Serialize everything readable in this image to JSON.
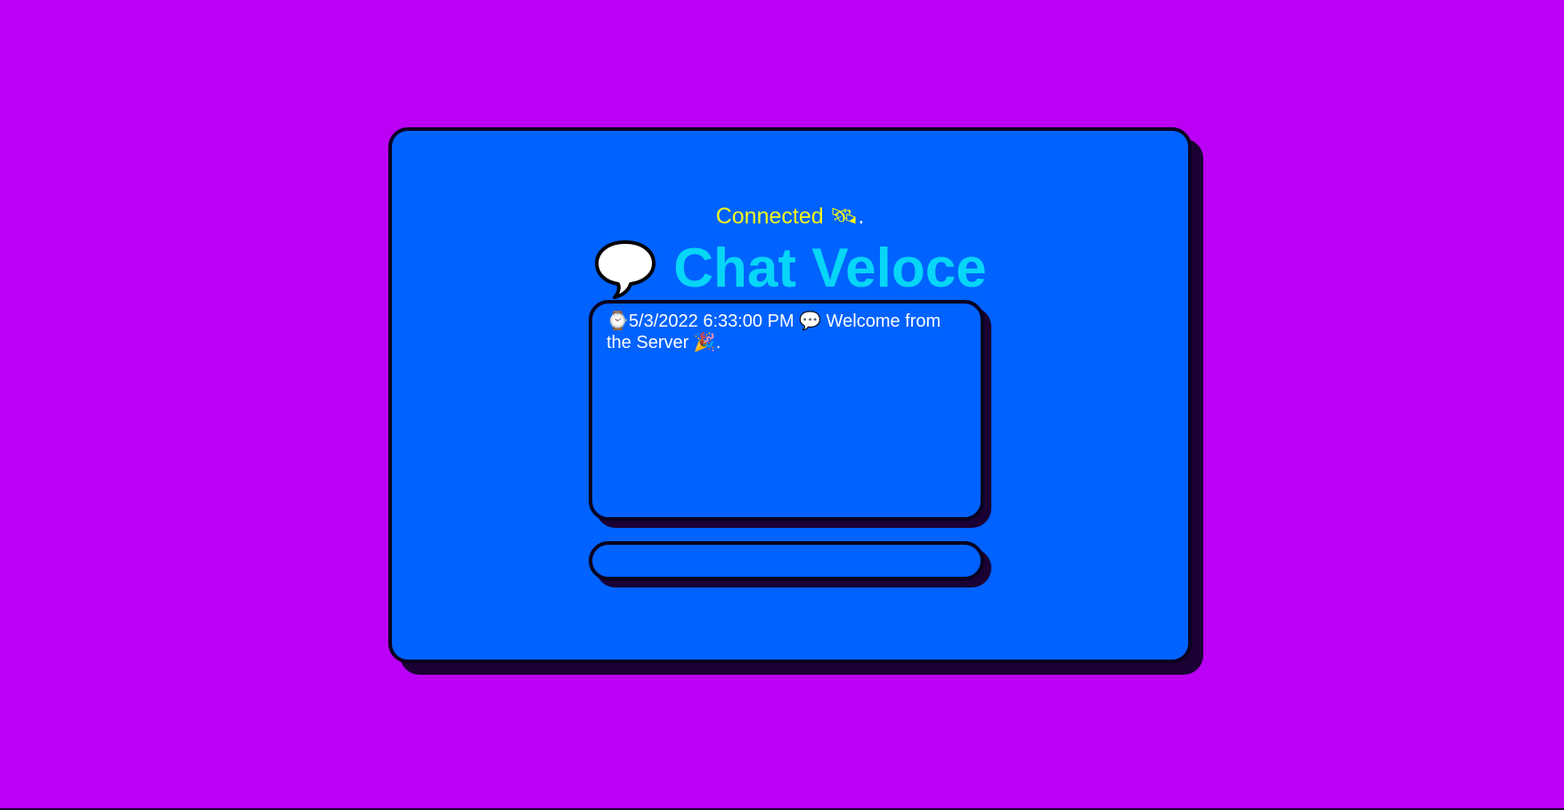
{
  "app": {
    "status_text": "Connected 🛰",
    "status_dot": ".",
    "title": "Chat Veloce",
    "title_icon": "speech-balloon-icon"
  },
  "messages": [
    {
      "timestamp_icon": "⌚",
      "timestamp": "5/3/2022 6:33:00 PM",
      "separator_icon": "💬",
      "text": "Welcome from the Server 🎉."
    }
  ],
  "composer": {
    "value": "",
    "placeholder": ""
  },
  "colors": {
    "background": "#bb00f5",
    "card": "#0062ff",
    "status": "#f4f91a",
    "title": "#06d6f7",
    "border": "#0a0020"
  }
}
